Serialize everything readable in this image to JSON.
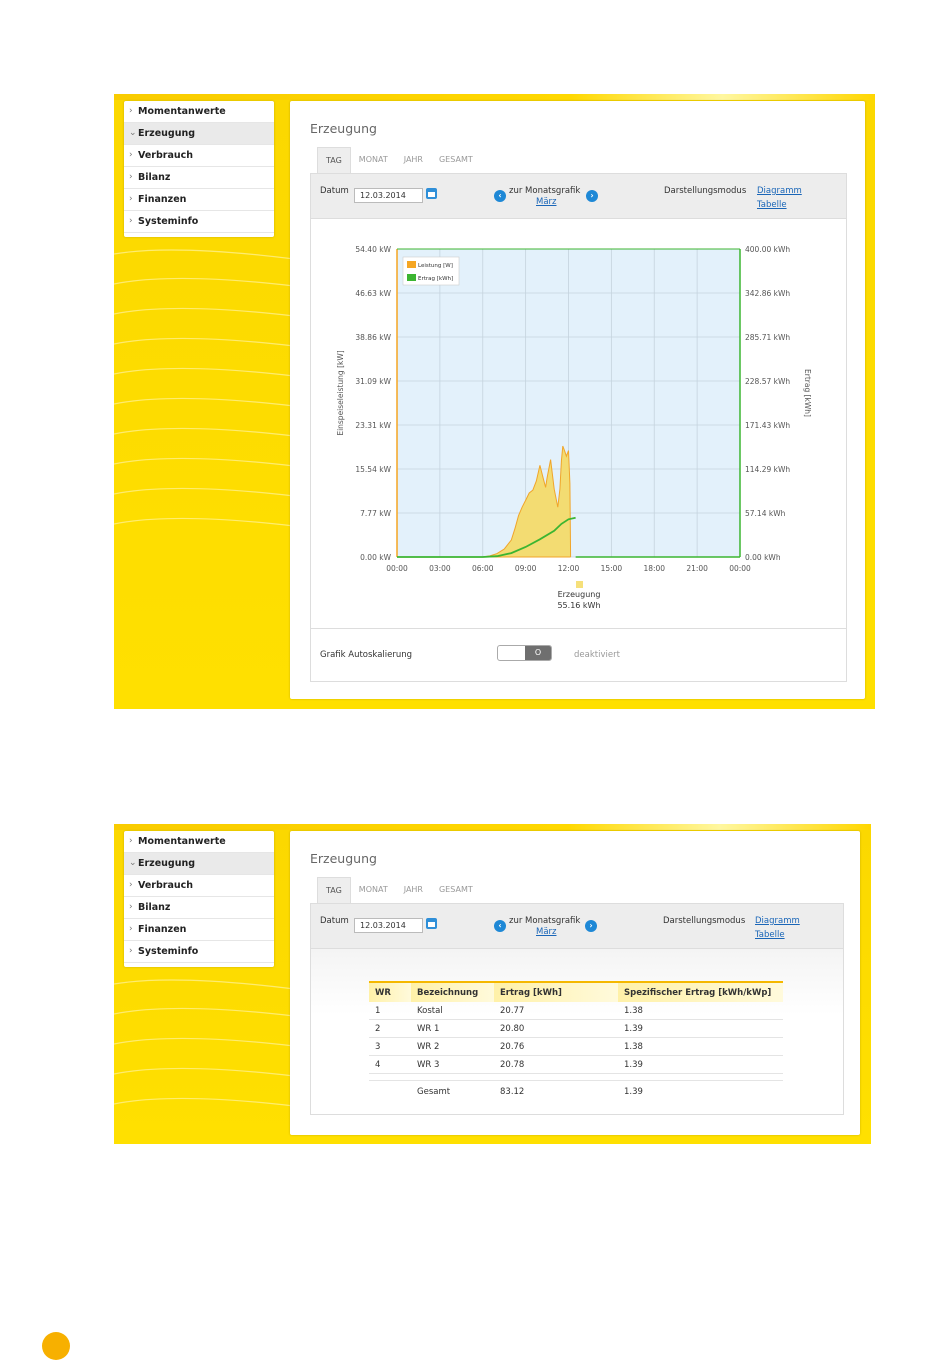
{
  "sidebar": {
    "items": [
      {
        "label": "Momentanwerte",
        "chevron": "›"
      },
      {
        "label": "Erzeugung",
        "chevron": "⌄"
      },
      {
        "label": "Verbrauch",
        "chevron": "›"
      },
      {
        "label": "Bilanz",
        "chevron": "›"
      },
      {
        "label": "Finanzen",
        "chevron": "›"
      },
      {
        "label": "Systeminfo",
        "chevron": "›"
      }
    ]
  },
  "page": {
    "title": "Erzeugung",
    "tabs": [
      "TAG",
      "MONAT",
      "JAHR",
      "GESAMT"
    ],
    "date_label": "Datum",
    "date_value": "12.03.2014",
    "month_nav_label": "zur Monatsgrafik",
    "month_link": "März",
    "mode_label": "Darstellungsmodus",
    "mode_diagram": "Diagramm",
    "mode_table": "Tabelle"
  },
  "chart_data": {
    "type": "area",
    "left_axis_label": "Einspeiseleistung [kW]",
    "right_axis_label": "Ertrag [kWh]",
    "left_ticks": [
      "54.40 kW",
      "46.63 kW",
      "38.86 kW",
      "31.09 kW",
      "23.31 kW",
      "15.54 kW",
      "7.77 kW",
      "0.00 kW"
    ],
    "right_ticks": [
      "400.00 kWh",
      "342.86 kWh",
      "285.71 kWh",
      "228.57 kWh",
      "171.43 kWh",
      "114.29 kWh",
      "57.14 kWh",
      "0.00 kWh"
    ],
    "x_ticks": [
      "00:00",
      "03:00",
      "06:00",
      "09:00",
      "12:00",
      "15:00",
      "18:00",
      "21:00",
      "00:00"
    ],
    "ylim_left": [
      0,
      54.4
    ],
    "ylim_right": [
      0,
      400
    ],
    "legend": [
      {
        "name": "Leistung [W]",
        "color": "#f5a623"
      },
      {
        "name": "Ertrag [kWh]",
        "color": "#3cb531"
      }
    ],
    "series": [
      {
        "name": "Leistung [W]",
        "unit": "kW",
        "x": [
          6.0,
          6.5,
          7.0,
          7.5,
          8.0,
          8.25,
          8.5,
          8.75,
          9.0,
          9.25,
          9.5,
          9.75,
          10.0,
          10.25,
          10.4,
          10.5,
          10.75,
          11.0,
          11.25,
          11.4,
          11.5,
          11.6,
          11.75,
          11.85,
          12.0,
          12.1,
          12.15
        ],
        "values": [
          0,
          0.2,
          0.6,
          1.4,
          3.0,
          5.0,
          7.3,
          8.8,
          10.0,
          11.3,
          11.8,
          13.4,
          16.2,
          13.7,
          12.3,
          14.0,
          17.2,
          12.0,
          8.8,
          12.0,
          17.0,
          19.6,
          18.6,
          17.8,
          18.8,
          13.0,
          0
        ]
      },
      {
        "name": "Ertrag [kWh]",
        "unit": "kWh",
        "x": [
          6.0,
          7.0,
          8.0,
          9.0,
          10.0,
          11.0,
          11.5,
          12.0,
          12.5
        ],
        "values": [
          0,
          1,
          5,
          13,
          23,
          34,
          43,
          49,
          51
        ]
      }
    ],
    "summary_label": "Erzeugung",
    "summary_value": "55.16 kWh",
    "summary_color": "#f6e07a"
  },
  "autoscale": {
    "label": "Grafik Autoskalierung",
    "state": "deaktiviert",
    "knob": "O"
  },
  "table": {
    "headers": [
      "WR",
      "Bezeichnung",
      "Ertrag [kWh]",
      "Spezifischer Ertrag [kWh/kWp]"
    ],
    "rows": [
      [
        "1",
        "Kostal",
        "20.77",
        "1.38"
      ],
      [
        "2",
        "WR 1",
        "20.80",
        "1.39"
      ],
      [
        "3",
        "WR 2",
        "20.76",
        "1.38"
      ],
      [
        "4",
        "WR 3",
        "20.78",
        "1.39"
      ]
    ],
    "total": [
      "",
      "Gesamt",
      "83.12",
      "1.39"
    ]
  }
}
